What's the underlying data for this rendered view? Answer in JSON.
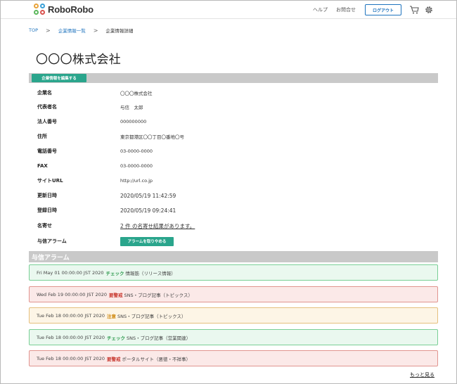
{
  "header": {
    "logo_text": "RoboRobo",
    "help": "ヘルプ",
    "contact": "お問合せ",
    "logout": "ログアウト",
    "icons": [
      "cart-icon",
      "gear-icon"
    ]
  },
  "breadcrumb": {
    "top": "TOP",
    "list": "企業情報一覧",
    "current": "企業情報詳細",
    "sep": ">"
  },
  "page": {
    "title": "〇〇〇株式会社",
    "edit_button": "企業情報を編集する"
  },
  "info": {
    "rows": [
      {
        "label": "企業名",
        "value": "〇〇〇株式会社"
      },
      {
        "label": "代表者名",
        "value": "与信　太郎"
      },
      {
        "label": "法人番号",
        "value": "000000000"
      },
      {
        "label": "住所",
        "value": "東京都港区〇〇丁目〇番地〇号"
      },
      {
        "label": "電話番号",
        "value": "03-0000-0000"
      },
      {
        "label": "FAX",
        "value": "03-0000-0000"
      },
      {
        "label": "サイトURL",
        "value": "http://url.co.jp"
      },
      {
        "label": "更新日時",
        "value": "2020/05/19 11:42:59"
      },
      {
        "label": "登録日時",
        "value": "2020/05/19 09:24:41"
      },
      {
        "label": "名寄せ",
        "value": "2 件 の名寄せ結果があります。"
      },
      {
        "label": "与信アラーム",
        "value": "アラームを取りやめる"
      }
    ]
  },
  "alarms": {
    "section_title": "与信アラーム",
    "items": [
      {
        "date": "Fri May 01 00:00:00 JST 2020",
        "tag": "チェック",
        "body": "情報筋（リリース情報）",
        "level": "green"
      },
      {
        "date": "Wed Feb 19 00:00:00 JST 2020",
        "tag": "要警戒",
        "body": "SNS・ブログ記事（トピックス）",
        "level": "red"
      },
      {
        "date": "Tue Feb 18 00:00:00 JST 2020",
        "tag": "注意",
        "body": "SNS・ブログ記事（トピックス）",
        "level": "yellow"
      },
      {
        "date": "Tue Feb 18 00:00:00 JST 2020",
        "tag": "チェック",
        "body": "SNS・ブログ記事（営業関連）",
        "level": "green"
      },
      {
        "date": "Tue Feb 18 00:00:00 JST 2020",
        "tag": "要警戒",
        "body": "ポータルサイト（悪徳・不祥事）",
        "level": "red"
      }
    ],
    "more": "もっと見る"
  },
  "colors": {
    "accent": "#2aa58c",
    "link": "#1e73be",
    "section_bar": "#c9c9c9"
  }
}
